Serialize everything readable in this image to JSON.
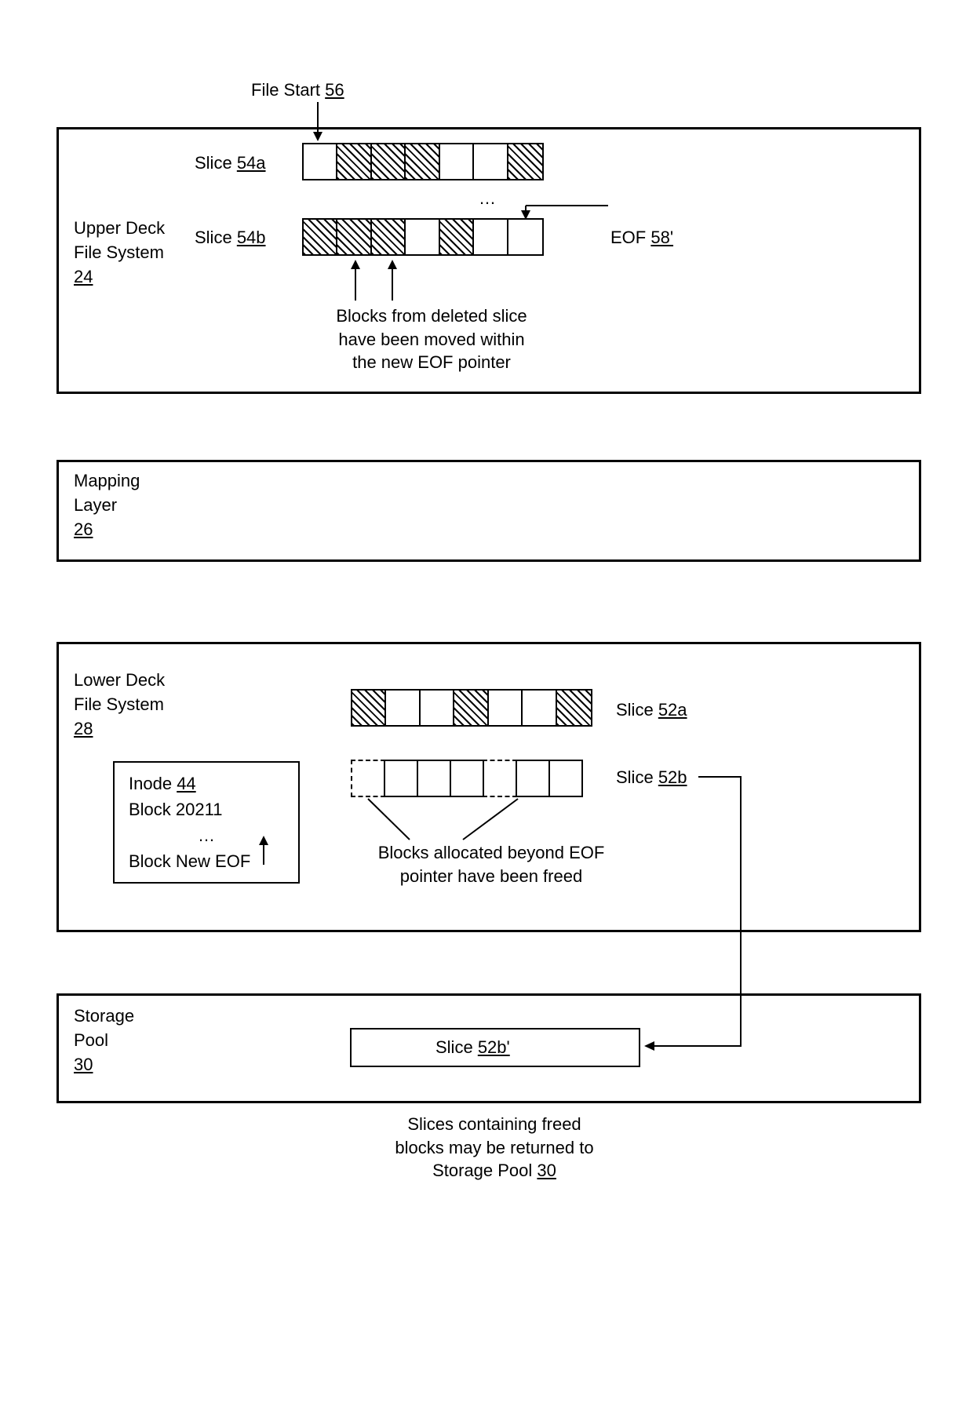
{
  "fileStart": {
    "text": "File Start",
    "ref": "56"
  },
  "slice54a": {
    "text": "Slice",
    "ref": "54a"
  },
  "slice54b": {
    "text": "Slice",
    "ref": "54b"
  },
  "upperDeck": {
    "line1": "Upper Deck",
    "line2": "File System",
    "ref": "24"
  },
  "eof": {
    "text": "EOF",
    "ref": "58'"
  },
  "blocksMoved": {
    "l1": "Blocks from deleted slice",
    "l2": "have been moved within",
    "l3": "the new EOF pointer"
  },
  "ellipsis": "…",
  "mapping": {
    "line1": "Mapping",
    "line2": "Layer",
    "ref": "26"
  },
  "lowerDeck": {
    "line1": "Lower Deck",
    "line2": "File System",
    "ref": "28"
  },
  "inode": {
    "header": "Inode",
    "ref": "44",
    "l1": "Block 20211",
    "l2": "…",
    "l3": "Block New EOF"
  },
  "slice52a": {
    "text": "Slice",
    "ref": "52a"
  },
  "slice52b": {
    "text": "Slice",
    "ref": "52b"
  },
  "blocksFreed": {
    "l1": "Blocks allocated beyond EOF",
    "l2": "pointer have been freed"
  },
  "storagePool": {
    "line1": "Storage",
    "line2": "Pool",
    "ref": "30"
  },
  "slice52bp": {
    "text": "Slice",
    "ref": "52b'"
  },
  "returned": {
    "l1": "Slices containing freed",
    "l2": "blocks may be returned to",
    "l3": "Storage Pool",
    "ref": "30"
  }
}
